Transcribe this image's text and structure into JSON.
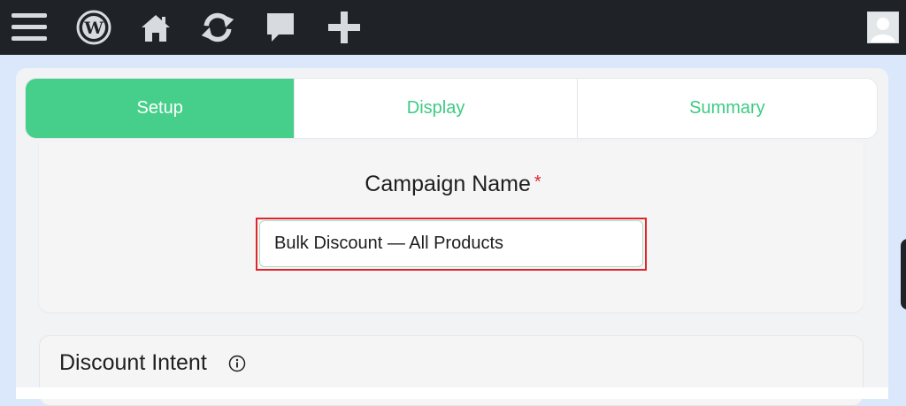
{
  "toolbar": {
    "icons": [
      "menu-icon",
      "wordpress-icon",
      "home-icon",
      "refresh-icon",
      "comment-icon",
      "plus-icon"
    ],
    "avatar": "user-avatar"
  },
  "tabs": [
    {
      "label": "Setup",
      "active": true
    },
    {
      "label": "Display",
      "active": false
    },
    {
      "label": "Summary",
      "active": false
    }
  ],
  "campaign": {
    "label": "Campaign Name",
    "required_mark": "*",
    "value": "Bulk Discount — All Products"
  },
  "intent": {
    "title": "Discount Intent",
    "info_icon": "info-icon"
  },
  "colors": {
    "accent": "#45cf8a",
    "accent_text": "#3ccb84",
    "topbar": "#1f2327",
    "required": "#e0262c"
  }
}
